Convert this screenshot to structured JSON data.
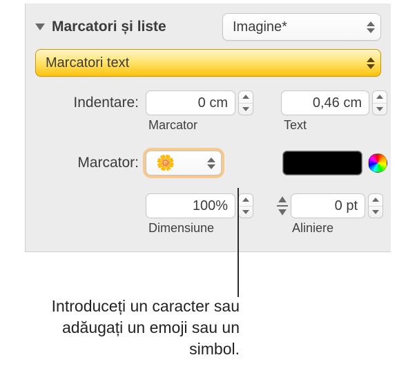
{
  "header": {
    "title": "Marcatori și liste",
    "style_select": "Imagine*"
  },
  "type_select": "Marcatori text",
  "indent": {
    "label": "Indentare:",
    "bullet_value": "0 cm",
    "bullet_caption": "Marcator",
    "text_value": "0,46 cm",
    "text_caption": "Text"
  },
  "bullet": {
    "label": "Marcator:",
    "symbol": "🌼",
    "color": "#000000"
  },
  "size": {
    "value": "100%",
    "caption": "Dimensiune"
  },
  "align": {
    "value": "0 pt",
    "caption": "Aliniere"
  },
  "callout": "Introduceți un caracter sau adăugați un emoji sau un simbol."
}
